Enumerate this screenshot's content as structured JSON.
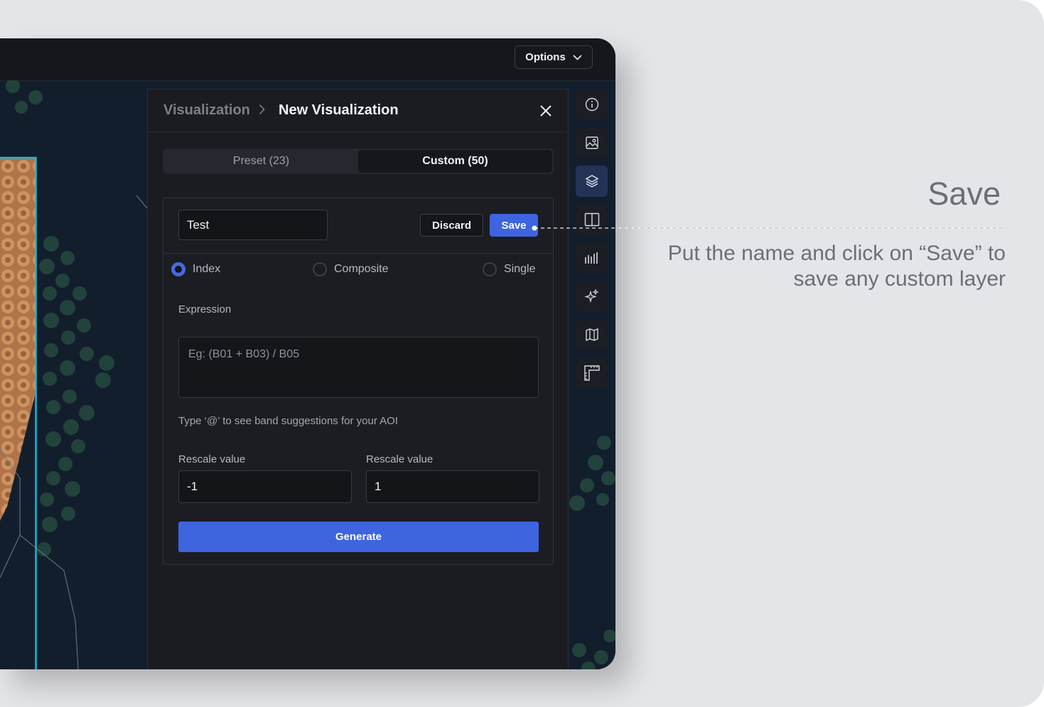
{
  "header": {
    "options_label": "Options"
  },
  "panel": {
    "breadcrumb_root": "Visualization",
    "breadcrumb_current": "New Visualization",
    "tabs": [
      {
        "label": "Preset (23)",
        "active": false
      },
      {
        "label": "Custom (50)",
        "active": true
      }
    ],
    "name_value": "Test",
    "discard_label": "Discard",
    "save_label": "Save",
    "modes": [
      {
        "label": "Index",
        "checked": true
      },
      {
        "label": "Composite",
        "checked": false
      },
      {
        "label": "Single",
        "checked": false
      }
    ],
    "expression_label": "Expression",
    "expression_placeholder": "Eg: (B01 + B03) / B05",
    "hint": "Type ‘@’ to see band suggestions for your AOI",
    "rescale_min_label": "Rescale value",
    "rescale_min_value": "-1",
    "rescale_max_label": "Rescale value",
    "rescale_max_value": "1",
    "generate_label": "Generate"
  },
  "toolbar": {
    "items": [
      {
        "icon": "info-icon",
        "active": false
      },
      {
        "icon": "image-icon",
        "active": false
      },
      {
        "icon": "layers-icon",
        "active": true
      },
      {
        "icon": "split-view-icon",
        "active": false
      },
      {
        "icon": "bar-chart-icon",
        "active": false
      },
      {
        "icon": "sparkle-icon",
        "active": false
      },
      {
        "icon": "map-icon",
        "active": false
      },
      {
        "icon": "ruler-icon",
        "active": false
      }
    ]
  },
  "annotation": {
    "title": "Save",
    "body_line1": "Put the name and click on “Save” to",
    "body_line2": "save any custom layer"
  },
  "colors": {
    "accent": "#3e64df",
    "panel_bg": "#1a1c21",
    "map_bg": "#131e2d",
    "outer_bg": "#e4e5e8",
    "aoi_outline": "#1fb6d8"
  }
}
